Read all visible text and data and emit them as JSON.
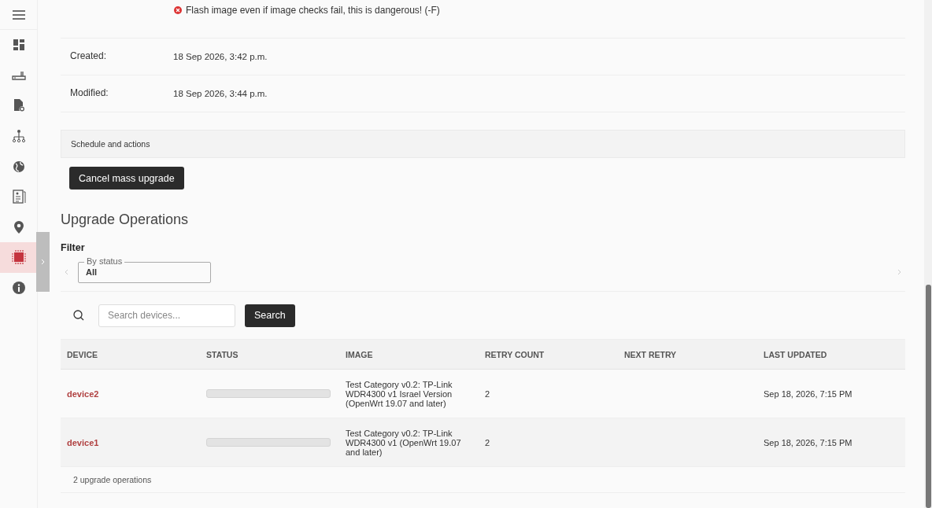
{
  "sidebar": {
    "items": [
      {
        "kind": "dashboard",
        "selected": false
      },
      {
        "kind": "router",
        "selected": false
      },
      {
        "kind": "file-gear",
        "selected": false
      },
      {
        "kind": "network",
        "selected": false
      },
      {
        "kind": "globe",
        "selected": false
      },
      {
        "kind": "clipboard",
        "selected": false
      },
      {
        "kind": "pin",
        "selected": false
      },
      {
        "kind": "chip",
        "selected": true
      },
      {
        "kind": "info",
        "selected": false
      }
    ]
  },
  "options": [
    {
      "text": "Flash image even if image checks fail, this is dangerous! (-F)",
      "checked": false
    }
  ],
  "details": [
    {
      "label": "Created:",
      "value": "18 Sep 2026, 3:42 p.m."
    },
    {
      "label": "Modified:",
      "value": "18 Sep 2026, 3:44 p.m."
    }
  ],
  "schedule_section": {
    "title": "Schedule and actions",
    "button": "Cancel mass upgrade"
  },
  "operations": {
    "title": "Upgrade Operations",
    "filter_title": "Filter",
    "filter": {
      "label": "By status",
      "value": "All"
    },
    "search": {
      "placeholder": "Search devices...",
      "button": "Search"
    },
    "table": {
      "columns": [
        "DEVICE",
        "STATUS",
        "IMAGE",
        "RETRY COUNT",
        "NEXT RETRY",
        "LAST UPDATED"
      ],
      "rows": [
        {
          "device": "device2",
          "level": 0,
          "image": "Test Category v0.2: TP-Link WDR4300 v1 Israel Version (OpenWrt 19.07 and later)",
          "retry_count": "2",
          "last_updated": "Sep 18, 2026, 7:15 PM"
        },
        {
          "device": "device1",
          "level": 0,
          "image": "Test Category v0.2: TP-Link WDR4300 v1 (OpenWrt 19.07 and later)",
          "retry_count": "2",
          "last_updated": "Sep 18, 2026, 7:15 PM"
        }
      ]
    },
    "footer": "2 upgrade operations"
  }
}
